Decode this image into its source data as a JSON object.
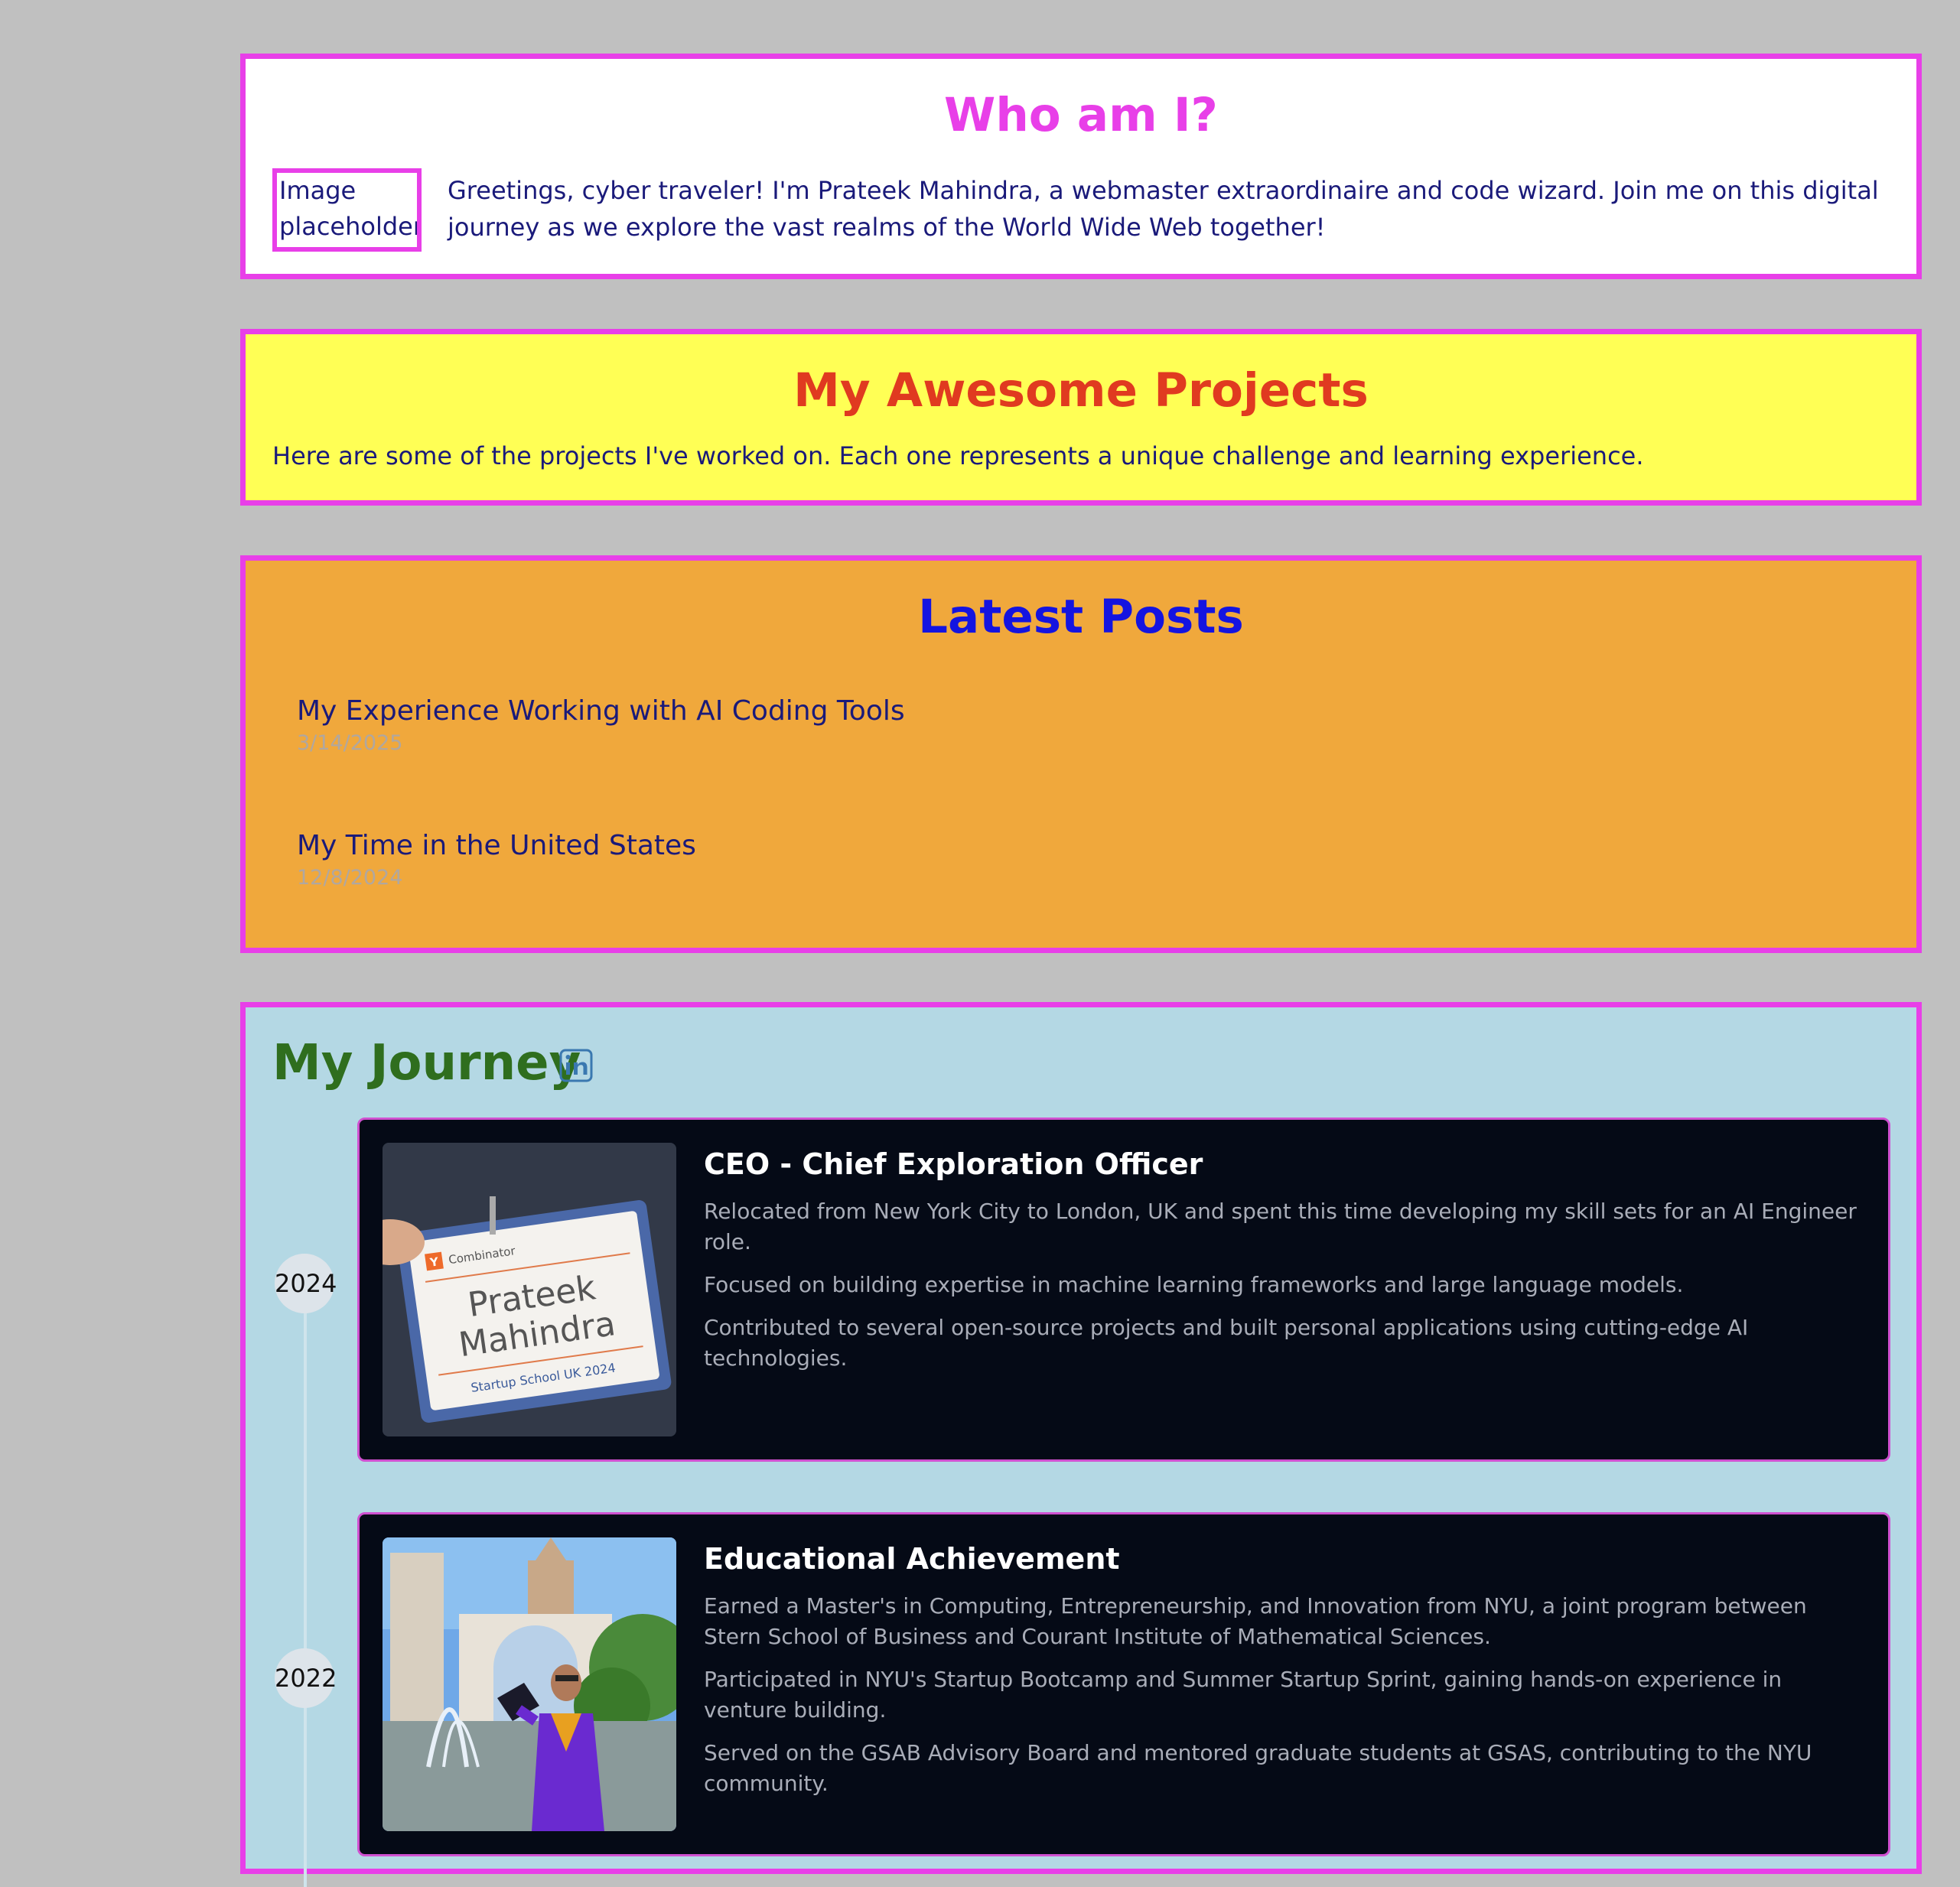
{
  "colors": {
    "page_bg": "#c0c0c0",
    "accent_border": "#e83fe8",
    "who_bg": "#ffffff",
    "projects_bg": "#ffff55",
    "posts_bg": "#f0a83c",
    "journey_bg": "#b4d8e4",
    "card_bg": "#050a16"
  },
  "who": {
    "title": "Who am I?",
    "image_placeholder": "Image placeholder",
    "intro": "Greetings, cyber traveler! I'm Prateek Mahindra, a webmaster extraordinaire and code wizard. Join me on this digital journey as we explore the vast realms of the World Wide Web together!"
  },
  "projects": {
    "title": "My Awesome Projects",
    "description": "Here are some of the projects I've worked on. Each one represents a unique challenge and learning experience."
  },
  "posts": {
    "title": "Latest Posts",
    "items": [
      {
        "title": "My Experience Working with AI Coding Tools",
        "date": "3/14/2025"
      },
      {
        "title": "My Time in the United States",
        "date": "12/8/2024"
      }
    ]
  },
  "journey": {
    "title": "My Journey",
    "linkedin_icon": "linkedin-icon",
    "entries": [
      {
        "year": "2024",
        "photo_label": "Y Combinator Startup School UK 2024 badge",
        "badge_org": "Combinator",
        "badge_name_line1": "Prateek",
        "badge_name_line2": "Mahindra",
        "badge_event": "Startup School UK 2024",
        "title": "CEO - Chief Exploration Officer",
        "lines": [
          "Relocated from New York City to London, UK and spent this time developing my skill sets for an AI Engineer role.",
          "Focused on building expertise in machine learning frameworks and large language models.",
          "Contributed to several open-source projects and built personal applications using cutting-edge AI technologies."
        ]
      },
      {
        "year": "2022",
        "photo_label": "Graduation photo at Washington Square Park",
        "title": "Educational Achievement",
        "lines": [
          "Earned a Master's in Computing, Entrepreneurship, and Innovation from NYU, a joint program between Stern School of Business and Courant Institute of Mathematical Sciences.",
          "Participated in NYU's Startup Bootcamp and Summer Startup Sprint, gaining hands-on experience in venture building.",
          "Served on the GSAB Advisory Board and mentored graduate students at GSAS, contributing to the NYU community."
        ]
      }
    ]
  }
}
